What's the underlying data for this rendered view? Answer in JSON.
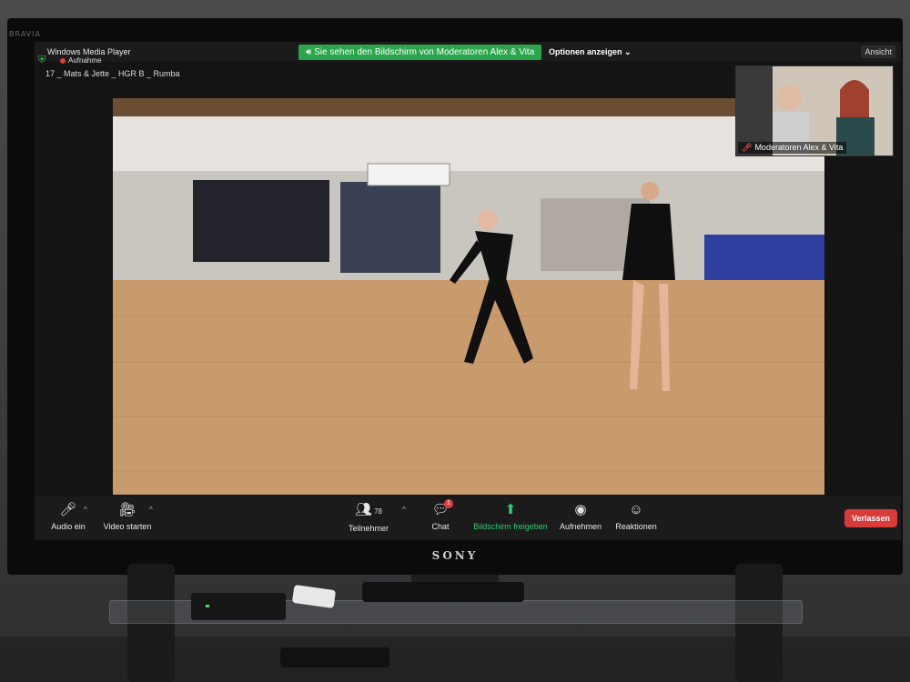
{
  "tv": {
    "brand": "SONY",
    "model_label": "BRAVIA"
  },
  "zoom": {
    "share_banner": "Sie sehen den Bildschirm von Moderatoren Alex & Vita",
    "options_label": "Optionen anzeigen",
    "view_label": "Ansicht",
    "window_title": "Windows Media Player",
    "recording_label": "Aufnahme",
    "clip_title": "17 _ Mats & Jette _ HGR B _ Rumba",
    "participant_label": "Moderatoren Alex & Vita"
  },
  "toolbar": {
    "audio_label": "Audio ein",
    "video_label": "Video starten",
    "participants_label": "Teilnehmer",
    "participants_count": "78",
    "chat_label": "Chat",
    "chat_badge": "1",
    "share_label": "Bildschirm freigeben",
    "record_label": "Aufnehmen",
    "reactions_label": "Reaktionen",
    "leave_label": "Verlassen"
  },
  "colors": {
    "share_green": "#2aa54b",
    "leave_red": "#d93a3a",
    "toolbar_bg": "#1b1b1b"
  },
  "icons": {
    "audio": "mic-muted-icon",
    "video": "camera-off-icon",
    "participants": "people-icon",
    "chat": "chat-bubble-icon",
    "share": "share-screen-icon",
    "record": "record-icon",
    "reactions": "smiley-plus-icon"
  }
}
